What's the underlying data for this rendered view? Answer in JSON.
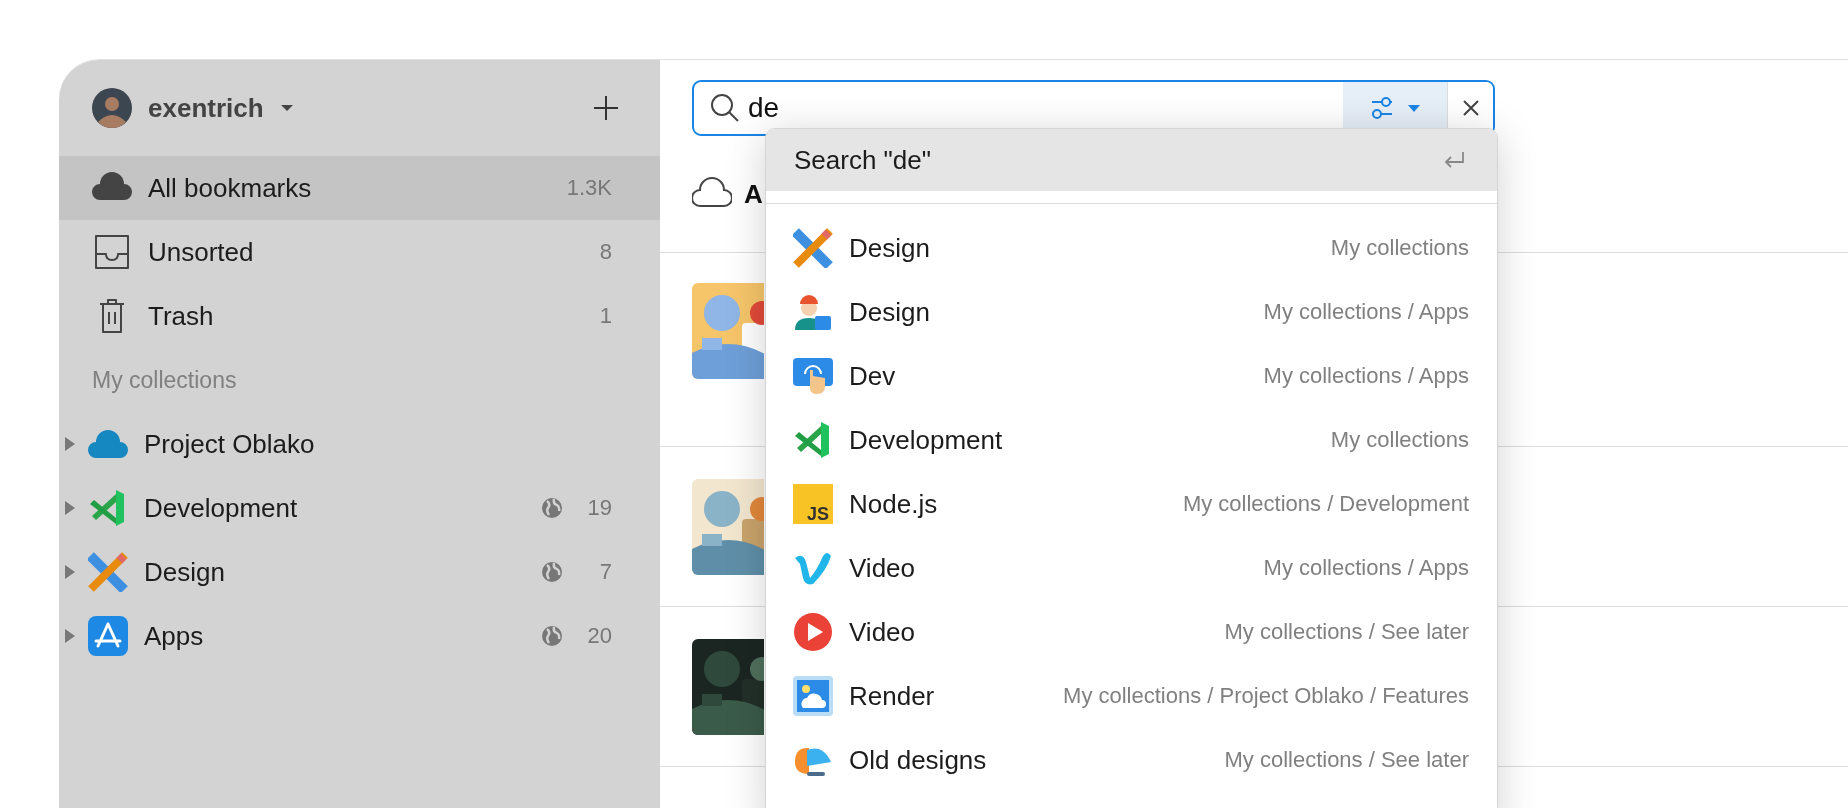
{
  "account": {
    "name": "exentrich"
  },
  "sidebar": {
    "items": [
      {
        "label": "All bookmarks",
        "count": "1.3K",
        "selected": true
      },
      {
        "label": "Unsorted",
        "count": "8",
        "selected": false
      },
      {
        "label": "Trash",
        "count": "1",
        "selected": false
      }
    ],
    "section": "My collections",
    "collections": [
      {
        "name": "Project Oblako",
        "shared": false,
        "expanded": false
      },
      {
        "name": "Development",
        "count": "19",
        "shared": true,
        "expanded": false
      },
      {
        "name": "Design",
        "count": "7",
        "shared": true,
        "expanded": false
      },
      {
        "name": "Apps",
        "count": "20",
        "shared": true,
        "expanded": false
      }
    ]
  },
  "search": {
    "value": "de"
  },
  "content": {
    "title": "A"
  },
  "suggestions": {
    "search_label": "Search \"de\"",
    "items": [
      {
        "name": "Design",
        "path": "My collections"
      },
      {
        "name": "Design",
        "path": "My collections / Apps"
      },
      {
        "name": "Dev",
        "path": "My collections / Apps"
      },
      {
        "name": "Development",
        "path": "My collections"
      },
      {
        "name": "Node.js",
        "path": "My collections / Development",
        "icon_text": "JS"
      },
      {
        "name": "Video",
        "path": "My collections / Apps"
      },
      {
        "name": "Video",
        "path": "My collections / See later"
      },
      {
        "name": "Render",
        "path": "My collections / Project Oblako / Features"
      },
      {
        "name": "Old designs",
        "path": "My collections / See later"
      }
    ]
  }
}
